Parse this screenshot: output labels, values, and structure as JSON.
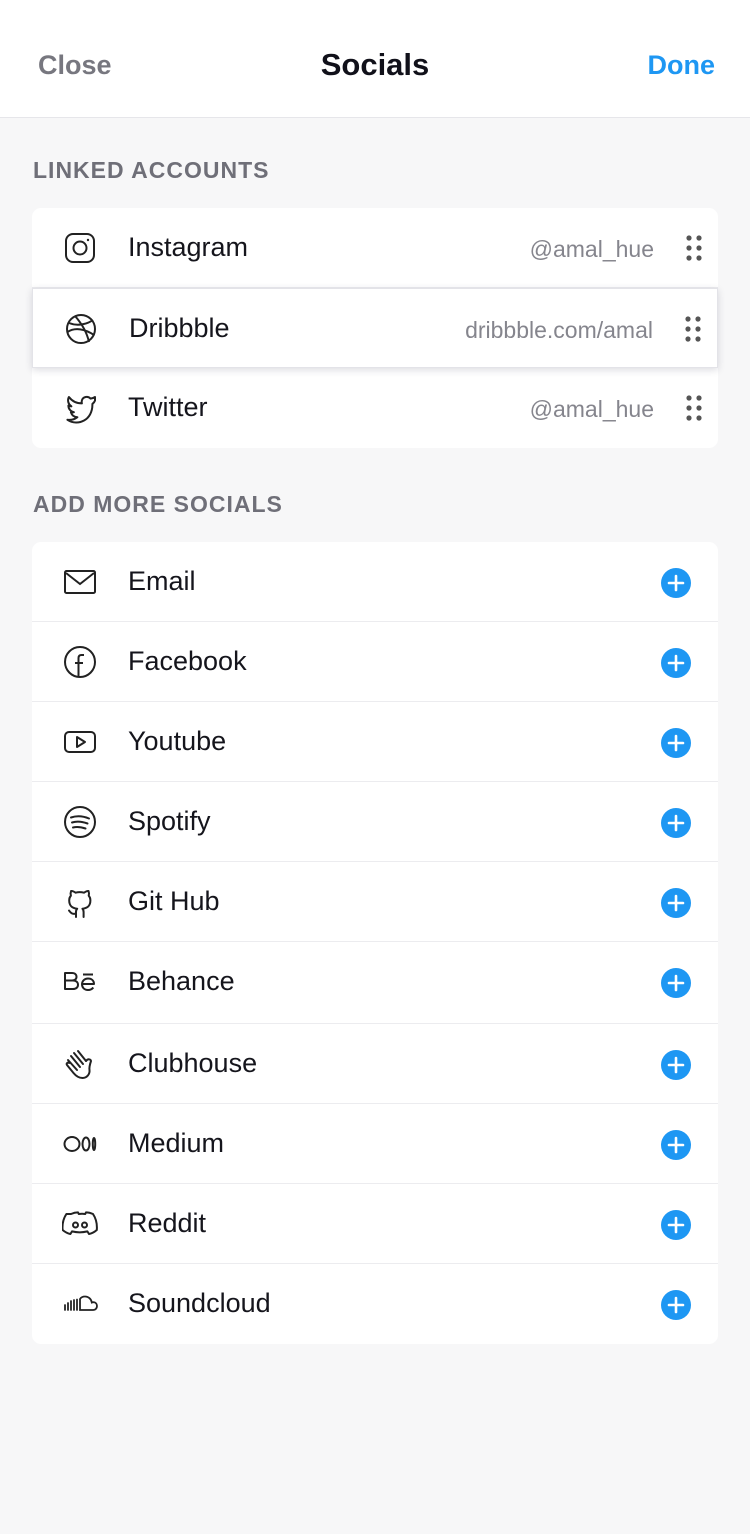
{
  "header": {
    "close_label": "Close",
    "title": "Socials",
    "done_label": "Done"
  },
  "linked": {
    "section_label": "LINKED ACCOUNTS",
    "items": [
      {
        "name": "Instagram",
        "handle": "@amal_hue",
        "icon": "instagram-icon"
      },
      {
        "name": "Dribbble",
        "handle": "dribbble.com/amal",
        "icon": "dribbble-icon"
      },
      {
        "name": "Twitter",
        "handle": "@amal_hue",
        "icon": "twitter-icon"
      }
    ]
  },
  "more": {
    "section_label": "ADD MORE SOCIALS",
    "items": [
      {
        "name": "Email",
        "icon": "email-icon"
      },
      {
        "name": "Facebook",
        "icon": "facebook-icon"
      },
      {
        "name": "Youtube",
        "icon": "youtube-icon"
      },
      {
        "name": "Spotify",
        "icon": "spotify-icon"
      },
      {
        "name": "Git Hub",
        "icon": "github-icon"
      },
      {
        "name": "Behance",
        "icon": "behance-icon"
      },
      {
        "name": "Clubhouse",
        "icon": "clubhouse-icon"
      },
      {
        "name": "Medium",
        "icon": "medium-icon"
      },
      {
        "name": "Reddit",
        "icon": "reddit-icon"
      },
      {
        "name": "Soundcloud",
        "icon": "soundcloud-icon"
      }
    ]
  },
  "colors": {
    "accent": "#1e97f3",
    "background": "#f7f7f8",
    "muted_text": "#77777f"
  }
}
